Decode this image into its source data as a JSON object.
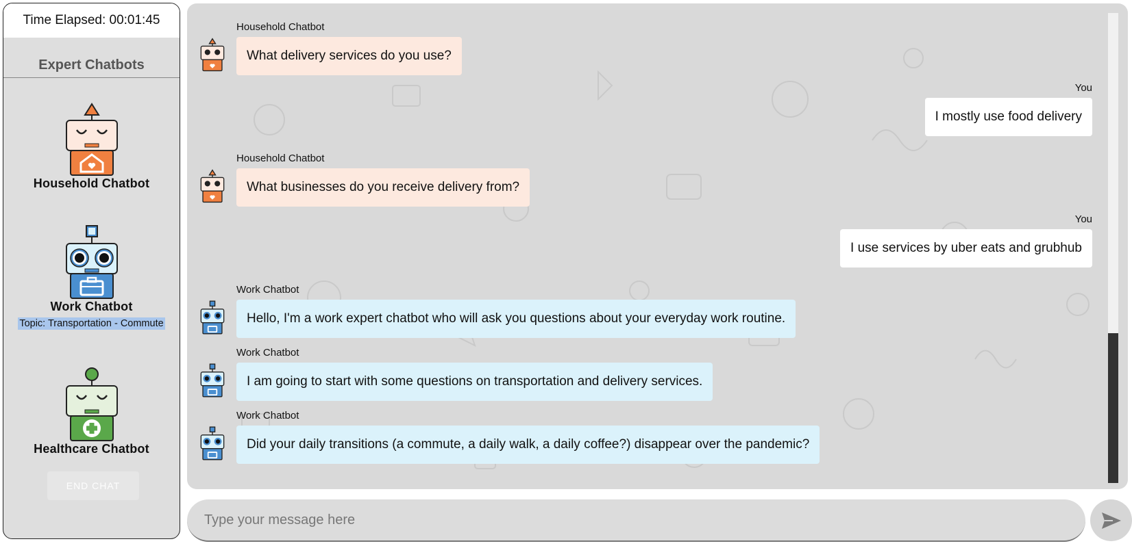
{
  "timer": {
    "label": "Time Elapsed: 00:01:45"
  },
  "sidebar": {
    "title": "Expert Chatbots",
    "bots": [
      {
        "name": "Household Chatbot",
        "color": "#f08040"
      },
      {
        "name": "Work Chatbot",
        "topic": "Topic: Transportation - Commute",
        "color": "#4a8fd0"
      },
      {
        "name": "Healthcare Chatbot",
        "color": "#5aa84a"
      }
    ],
    "end_chat_label": "END CHAT"
  },
  "chat": {
    "messages": [
      {
        "sender": "Household Chatbot",
        "text": "What delivery services do you use?",
        "kind": "household"
      },
      {
        "sender": "You",
        "text": "I mostly use food delivery",
        "kind": "user"
      },
      {
        "sender": "Household Chatbot",
        "text": "What businesses do you receive delivery from?",
        "kind": "household"
      },
      {
        "sender": "You",
        "text": "I use services by uber eats and grubhub",
        "kind": "user"
      },
      {
        "sender": "Work Chatbot",
        "text": "Hello, I'm a work expert chatbot who will ask you questions about your everyday work routine.",
        "kind": "work"
      },
      {
        "sender": "Work Chatbot",
        "text": "I am going to start with some questions on transportation and delivery services.",
        "kind": "work"
      },
      {
        "sender": "Work Chatbot",
        "text": "Did your daily transitions (a commute, a daily walk, a daily coffee?) disappear over the pandemic?",
        "kind": "work"
      }
    ]
  },
  "input": {
    "placeholder": "Type your message here",
    "value": ""
  },
  "send_button": {
    "icon": "send-icon"
  },
  "colors": {
    "household_bubble": "#fde9df",
    "work_bubble": "#dbf2fb",
    "user_bubble": "#ffffff",
    "topic_highlight": "#a9c6ec"
  }
}
